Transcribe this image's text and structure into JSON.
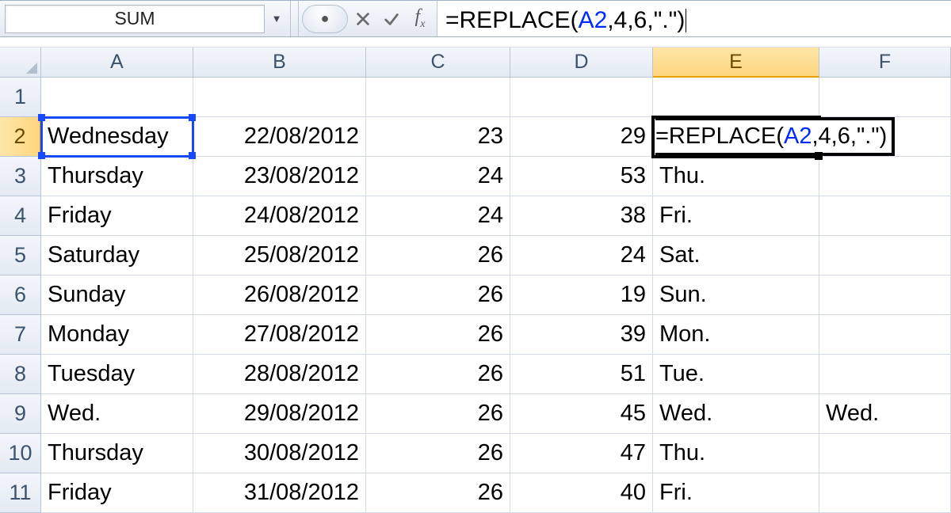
{
  "namebox": {
    "value": "SUM"
  },
  "formula_segments": [
    {
      "cls": "tok-fn",
      "t": "=REPLACE("
    },
    {
      "cls": "tok-ref",
      "t": "A2"
    },
    {
      "cls": "tok-fn",
      "t": ","
    },
    {
      "cls": "tok-num",
      "t": "4"
    },
    {
      "cls": "tok-fn",
      "t": ","
    },
    {
      "cls": "tok-num",
      "t": "6"
    },
    {
      "cls": "tok-fn",
      "t": ","
    },
    {
      "cls": "tok-str",
      "t": "\".\""
    },
    {
      "cls": "tok-fn",
      "t": ")"
    }
  ],
  "columns": [
    "A",
    "B",
    "C",
    "D",
    "E",
    "F"
  ],
  "active_col": "E",
  "active_row": 2,
  "ref_cell": "A2",
  "rows": [
    {
      "r": 1,
      "A": "",
      "B": "",
      "C": "",
      "D": "",
      "E": "",
      "F": ""
    },
    {
      "r": 2,
      "A": "Wednesday",
      "B": "22/08/2012",
      "C": "23",
      "D": "29",
      "E": "=REPLACE(A2,4,6,\".\")",
      "F": ""
    },
    {
      "r": 3,
      "A": "Thursday",
      "B": "23/08/2012",
      "C": "24",
      "D": "53",
      "E": "Thu.",
      "F": ""
    },
    {
      "r": 4,
      "A": "Friday",
      "B": "24/08/2012",
      "C": "24",
      "D": "38",
      "E": "Fri.",
      "F": ""
    },
    {
      "r": 5,
      "A": "Saturday",
      "B": "25/08/2012",
      "C": "26",
      "D": "24",
      "E": "Sat.",
      "F": ""
    },
    {
      "r": 6,
      "A": "Sunday",
      "B": "26/08/2012",
      "C": "26",
      "D": "19",
      "E": "Sun.",
      "F": ""
    },
    {
      "r": 7,
      "A": "Monday",
      "B": "27/08/2012",
      "C": "26",
      "D": "39",
      "E": "Mon.",
      "F": ""
    },
    {
      "r": 8,
      "A": "Tuesday",
      "B": "28/08/2012",
      "C": "26",
      "D": "51",
      "E": "Tue.",
      "F": ""
    },
    {
      "r": 9,
      "A": "Wed.",
      "B": "29/08/2012",
      "C": "26",
      "D": "45",
      "E": "Wed.",
      "F": "Wed."
    },
    {
      "r": 10,
      "A": "Thursday",
      "B": "30/08/2012",
      "C": "26",
      "D": "47",
      "E": "Thu.",
      "F": ""
    },
    {
      "r": 11,
      "A": "Friday",
      "B": "31/08/2012",
      "C": "26",
      "D": "40",
      "E": "Fri.",
      "F": ""
    }
  ],
  "right_aligned_cols": [
    "B",
    "C",
    "D"
  ]
}
